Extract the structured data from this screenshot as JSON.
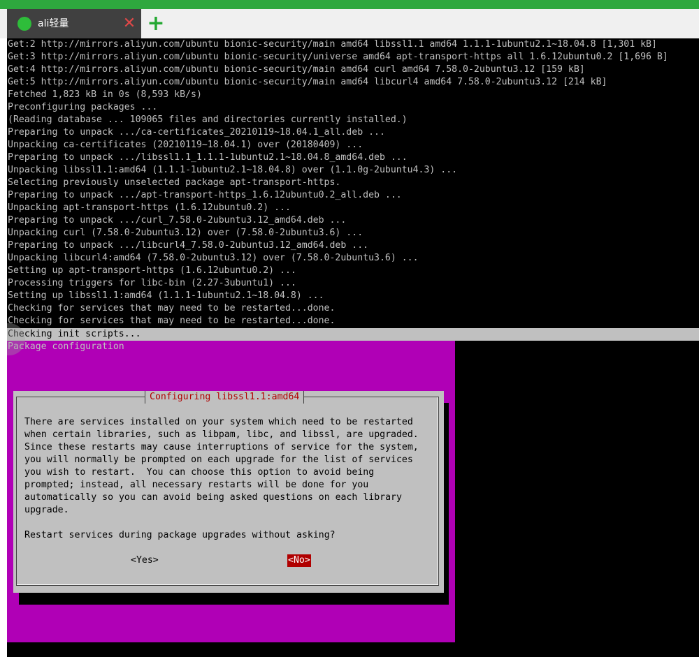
{
  "window": {
    "tab_title": "ali轻量",
    "tab_status": "connected",
    "accent": "#2ea83e",
    "close_icon": "close-icon",
    "new_tab_icon": "plus-icon"
  },
  "terminal": {
    "lines": [
      "Get:2 http://mirrors.aliyun.com/ubuntu bionic-security/main amd64 libssl1.1 amd64 1.1.1-1ubuntu2.1~18.04.8 [1,301 kB]",
      "Get:3 http://mirrors.aliyun.com/ubuntu bionic-security/universe amd64 apt-transport-https all 1.6.12ubuntu0.2 [1,696 B]",
      "Get:4 http://mirrors.aliyun.com/ubuntu bionic-security/main amd64 curl amd64 7.58.0-2ubuntu3.12 [159 kB]",
      "Get:5 http://mirrors.aliyun.com/ubuntu bionic-security/main amd64 libcurl4 amd64 7.58.0-2ubuntu3.12 [214 kB]",
      "Fetched 1,823 kB in 0s (8,593 kB/s)",
      "Preconfiguring packages ...",
      "(Reading database ... 109065 files and directories currently installed.)",
      "Preparing to unpack .../ca-certificates_20210119~18.04.1_all.deb ...",
      "Unpacking ca-certificates (20210119~18.04.1) over (20180409) ...",
      "Preparing to unpack .../libssl1.1_1.1.1-1ubuntu2.1~18.04.8_amd64.deb ...",
      "Unpacking libssl1.1:amd64 (1.1.1-1ubuntu2.1~18.04.8) over (1.1.0g-2ubuntu4.3) ...",
      "Selecting previously unselected package apt-transport-https.",
      "Preparing to unpack .../apt-transport-https_1.6.12ubuntu0.2_all.deb ...",
      "Unpacking apt-transport-https (1.6.12ubuntu0.2) ...",
      "Preparing to unpack .../curl_7.58.0-2ubuntu3.12_amd64.deb ...",
      "Unpacking curl (7.58.0-2ubuntu3.12) over (7.58.0-2ubuntu3.6) ...",
      "Preparing to unpack .../libcurl4_7.58.0-2ubuntu3.12_amd64.deb ...",
      "Unpacking libcurl4:amd64 (7.58.0-2ubuntu3.12) over (7.58.0-2ubuntu3.6) ...",
      "Setting up apt-transport-https (1.6.12ubuntu0.2) ...",
      "Processing triggers for libc-bin (2.27-3ubuntu1) ...",
      "Setting up libssl1.1:amd64 (1.1.1-1ubuntu2.1~18.04.8) ...",
      "Checking for services that may need to be restarted...done.",
      "Checking for services that may need to be restarted...done."
    ],
    "highlighted_line": "Checking init scripts...",
    "package_config_title": "Package configuration"
  },
  "dialog": {
    "title": "Configuring libssl1.1:amd64",
    "body_lines": [
      "There are services installed on your system which need to be restarted",
      "when certain libraries, such as libpam, libc, and libssl, are upgraded.",
      "Since these restarts may cause interruptions of service for the system,",
      "you will normally be prompted on each upgrade for the list of services",
      "you wish to restart.  You can choose this option to avoid being",
      "prompted; instead, all necessary restarts will be done for you",
      "automatically so you can avoid being asked questions on each library",
      "upgrade.",
      "",
      "Restart services during package upgrades without asking?"
    ],
    "yes_label": "<Yes>",
    "no_label": "<No>",
    "selected": "no"
  }
}
